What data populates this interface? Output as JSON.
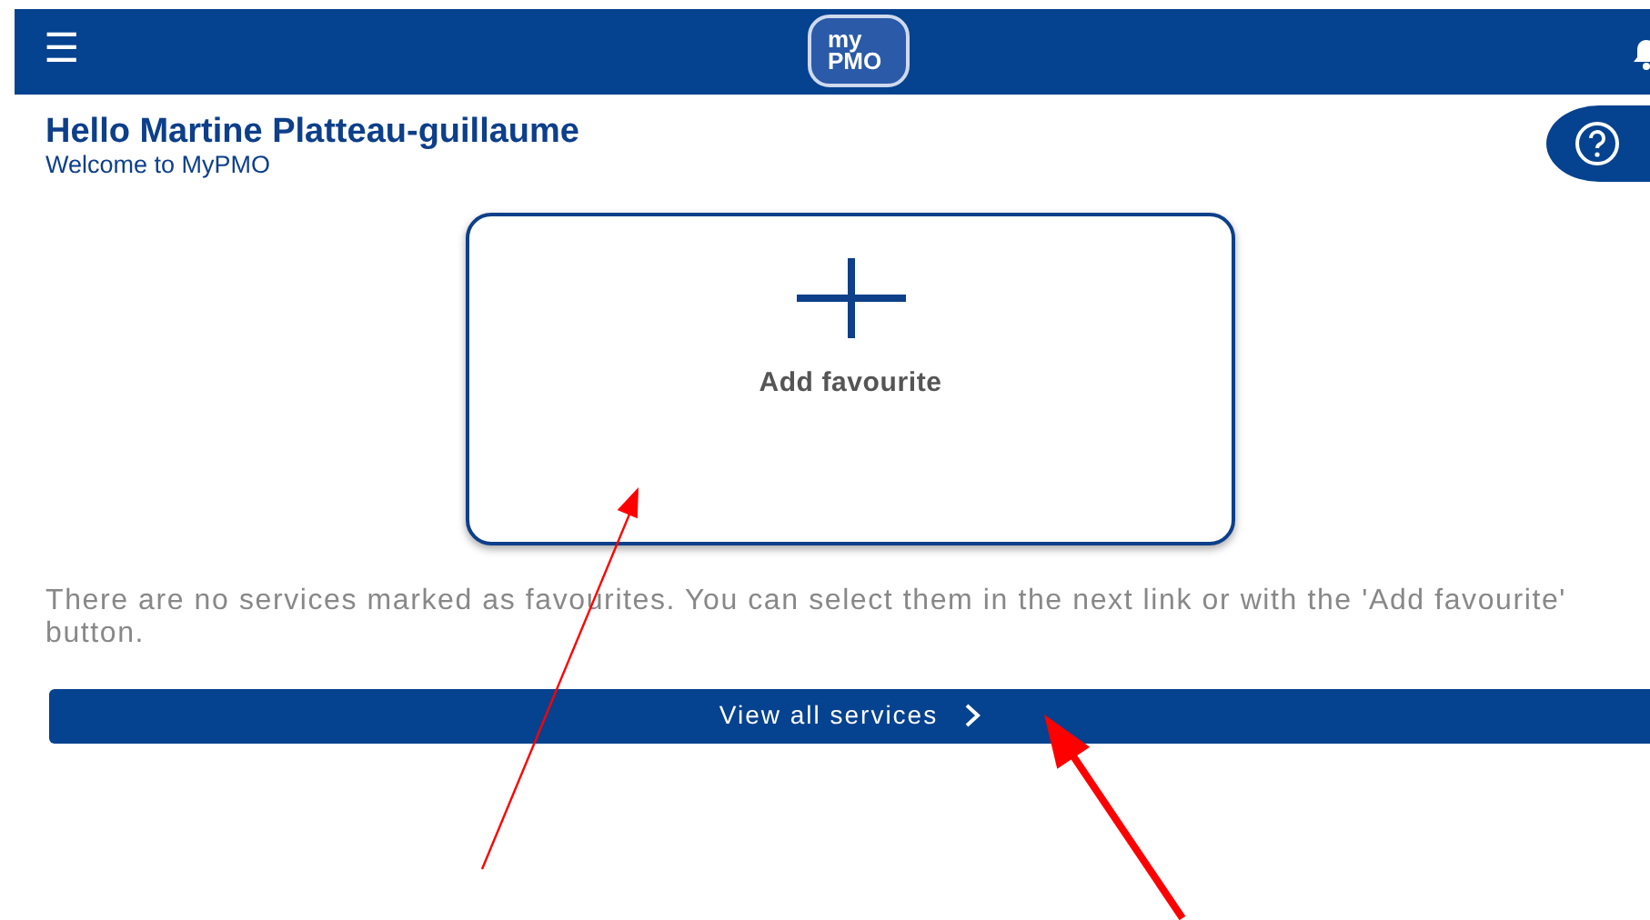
{
  "header": {
    "menu_icon": "☰",
    "logo": {
      "line_1": "my",
      "line_2": "PMO"
    }
  },
  "greeting": {
    "title": "Hello Martine Platteau-guillaume",
    "subtitle": "Welcome to MyPMO"
  },
  "add_favourite_card": {
    "label": "Add favourite"
  },
  "empty_message": "There are no services marked as favourites. You can select them in the next link or with the 'Add favourite' button.",
  "view_all_button": {
    "label": "View all services"
  },
  "annotations": [
    {
      "kind": "thin"
    },
    {
      "kind": "thick"
    }
  ]
}
